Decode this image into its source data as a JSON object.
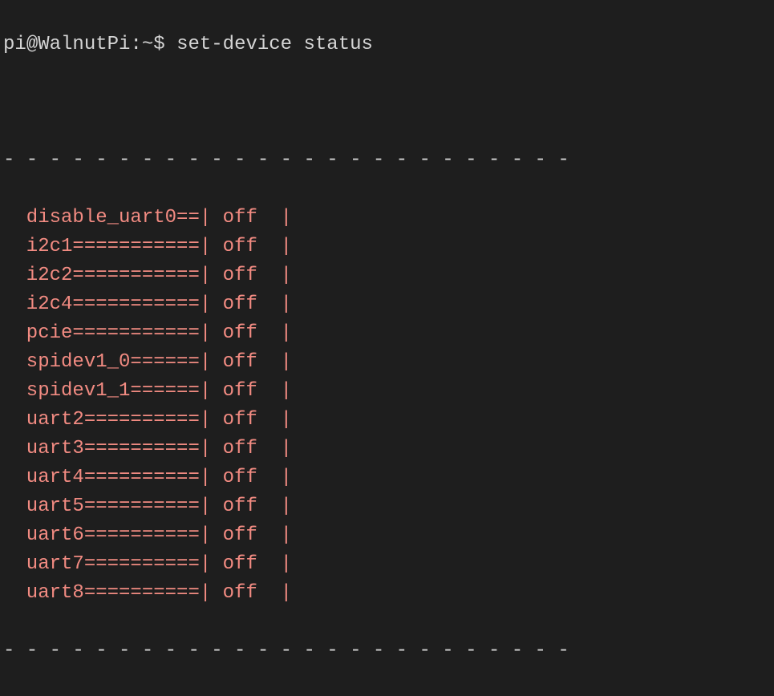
{
  "prompt": {
    "user": "pi",
    "host": "WalnutPi",
    "path": "~",
    "symbol": "$",
    "command": "set-device status"
  },
  "border": "- - - - - - - - - - - - - - - - - - - - - - - - -",
  "devices": [
    {
      "name": "disable_uart0",
      "status": "off"
    },
    {
      "name": "i2c1",
      "status": "off"
    },
    {
      "name": "i2c2",
      "status": "off"
    },
    {
      "name": "i2c4",
      "status": "off"
    },
    {
      "name": "pcie",
      "status": "off"
    },
    {
      "name": "spidev1_0",
      "status": "off"
    },
    {
      "name": "spidev1_1",
      "status": "off"
    },
    {
      "name": "uart2",
      "status": "off"
    },
    {
      "name": "uart3",
      "status": "off"
    },
    {
      "name": "uart4",
      "status": "off"
    },
    {
      "name": "uart5",
      "status": "off"
    },
    {
      "name": "uart6",
      "status": "off"
    },
    {
      "name": "uart7",
      "status": "off"
    },
    {
      "name": "uart8",
      "status": "off"
    }
  ]
}
